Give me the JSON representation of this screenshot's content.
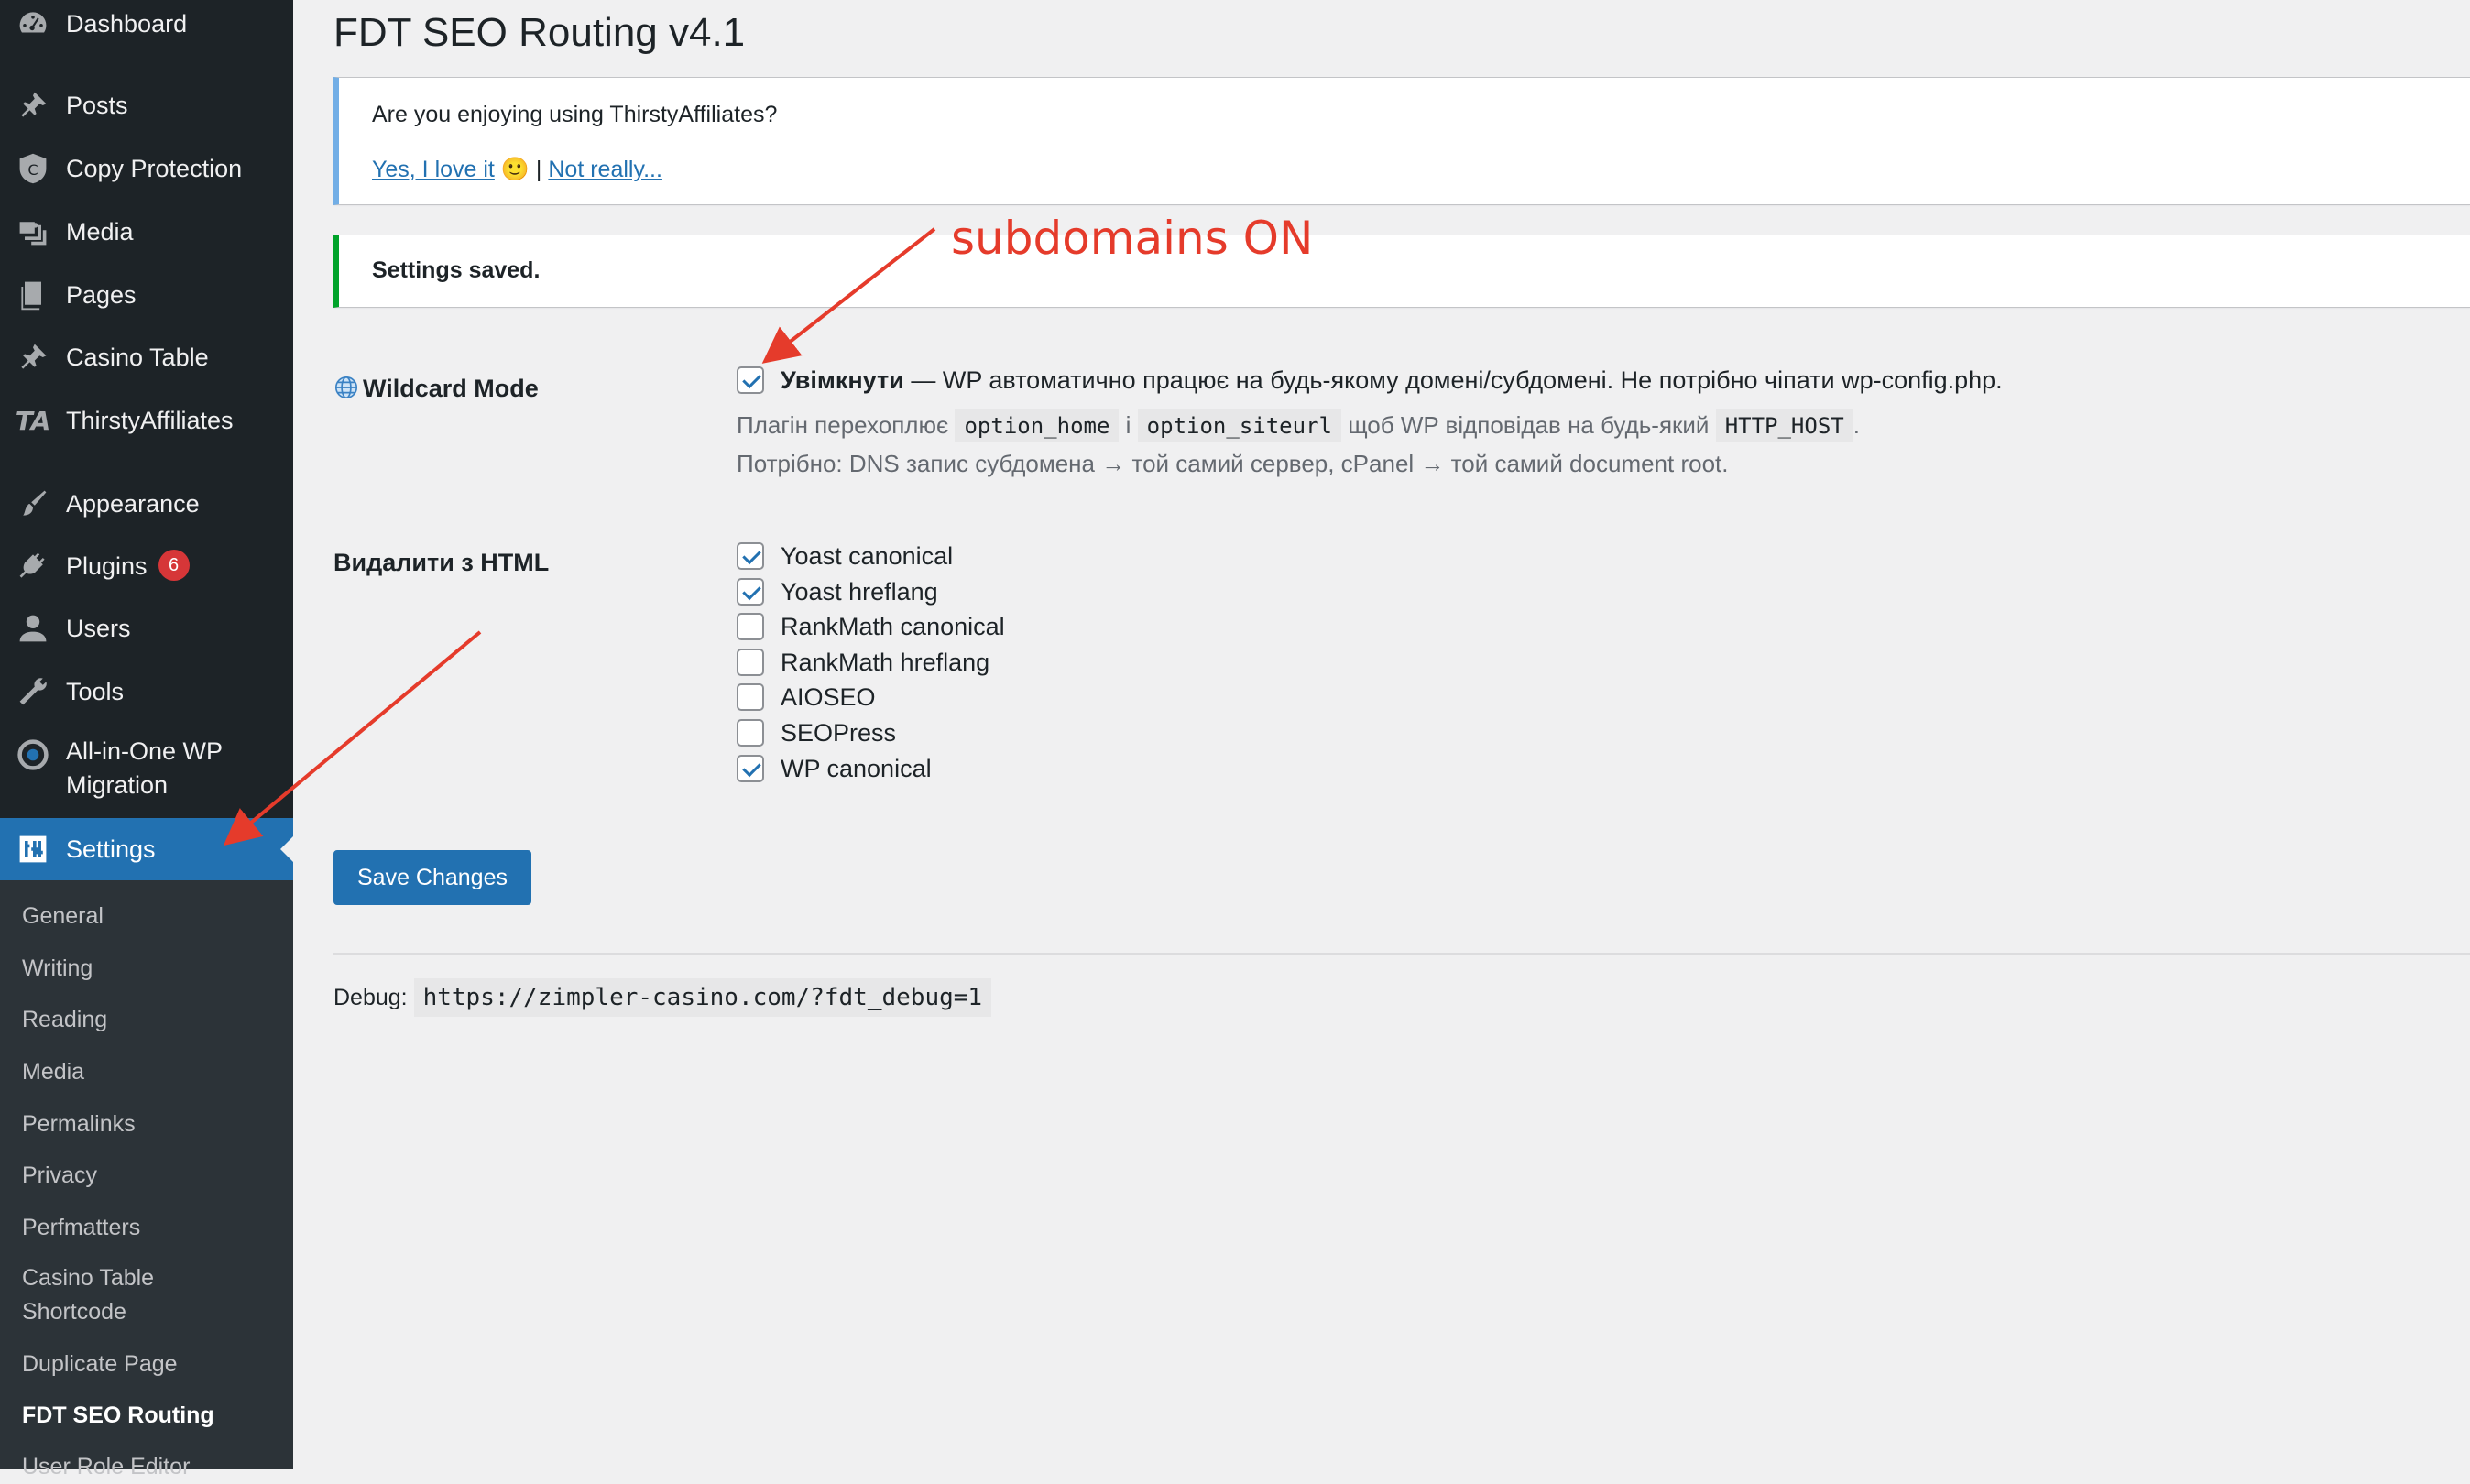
{
  "sidebar": {
    "items": [
      {
        "label": "Dashboard",
        "icon": "dashboard-icon"
      },
      {
        "label": "Posts",
        "icon": "pushpin-icon"
      },
      {
        "label": "Copy Protection",
        "icon": "shield-icon"
      },
      {
        "label": "Media",
        "icon": "media-icon"
      },
      {
        "label": "Pages",
        "icon": "pages-icon"
      },
      {
        "label": "Casino Table",
        "icon": "pushpin-icon"
      },
      {
        "label": "ThirstyAffiliates",
        "icon": "ta-logo-icon",
        "icon_text": "TA"
      },
      {
        "label": "Appearance",
        "icon": "paintbrush-icon"
      },
      {
        "label": "Plugins",
        "icon": "plug-icon",
        "badge": "6"
      },
      {
        "label": "Users",
        "icon": "user-icon"
      },
      {
        "label": "Tools",
        "icon": "wrench-icon"
      },
      {
        "label_line1": "All-in-One WP",
        "label_line2": "Migration",
        "icon": "migration-icon"
      },
      {
        "label": "Settings",
        "icon": "settings-icon",
        "current": true
      }
    ],
    "submenu": [
      "General",
      "Writing",
      "Reading",
      "Media",
      "Permalinks",
      "Privacy",
      "Perfmatters",
      "Casino Table",
      "Shortcode",
      "Duplicate Page",
      "FDT SEO Routing",
      "User Role Editor"
    ],
    "submenu_current": "FDT SEO Routing"
  },
  "page": {
    "title": "FDT SEO Routing v4.1"
  },
  "notice_affiliates": {
    "question": "Are you enjoying using ThirstyAffiliates?",
    "yes_link": "Yes, I love it",
    "emoji": "🙂",
    "separator": "|",
    "no_link": "Not really..."
  },
  "notice_saved": {
    "text": "Settings saved."
  },
  "wildcard": {
    "label": "Wildcard Mode",
    "icon": "globe-icon",
    "checked": true,
    "enabled_label": "Увімкнути",
    "enabled_desc": " — WP автоматично працює на будь-якому домені/субдомені. Не потрібно чіпати wp-config.php.",
    "line2_part1": "Плагін перехоплює",
    "code1": "option_home",
    "line2_part2": "і",
    "code2": "option_siteurl",
    "line2_part3": "щоб WP відповідав на будь-який",
    "code3": "HTTP_HOST",
    "line2_part4": ".",
    "line3": "Потрібно: DNS запис субдомена → той самий сервер, cPanel → той самий document root."
  },
  "remove_html": {
    "label": "Видалити з HTML",
    "options": [
      {
        "label": "Yoast canonical",
        "checked": true
      },
      {
        "label": "Yoast hreflang",
        "checked": true
      },
      {
        "label": "RankMath canonical",
        "checked": false
      },
      {
        "label": "RankMath hreflang",
        "checked": false
      },
      {
        "label": "AIOSEO",
        "checked": false
      },
      {
        "label": "SEOPress",
        "checked": false
      },
      {
        "label": "WP canonical",
        "checked": true
      }
    ]
  },
  "save_button": "Save Changes",
  "debug": {
    "label": "Debug:",
    "url": "https://zimpler-casino.com/?fdt_debug=1"
  },
  "annotation": {
    "text": "subdomains ON",
    "color": "#e53b2b"
  },
  "colors": {
    "sidebar_bg": "#1d2327",
    "submenu_bg": "#2c3338",
    "accent": "#2271b1",
    "success": "#00a32a",
    "info": "#72aee6",
    "badge": "#d63638"
  }
}
